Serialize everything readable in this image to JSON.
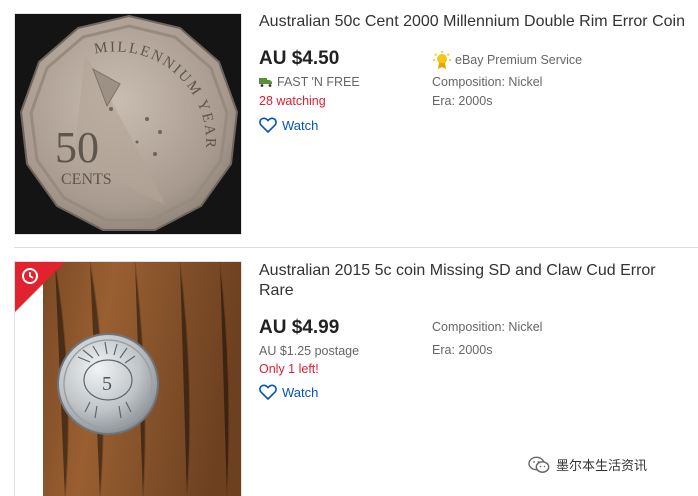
{
  "listings": [
    {
      "title": "Australian 50c Cent 2000 Millennium Double Rim Error Coin",
      "price": "AU $4.50",
      "shipping": "FAST 'N FREE",
      "watching": "28 watching",
      "watch_label": "Watch",
      "premium_label": "eBay Premium Service",
      "composition": "Composition: Nickel",
      "era": "Era: 2000s",
      "coin_text_top": "MILLENNIUM YEAR",
      "coin_text_value": "50",
      "coin_text_unit": "CENTS"
    },
    {
      "title": "Australian 2015 5c coin Missing SD and Claw Cud Error Rare",
      "price": "AU $4.99",
      "postage": "AU $1.25 postage",
      "stock": "Only 1 left!",
      "watch_label": "Watch",
      "composition": "Composition: Nickel",
      "era": "Era: 2000s"
    }
  ],
  "watermark": "墨尔本生活资讯",
  "colors": {
    "link": "#0654ba",
    "alert": "#dd1e31",
    "badge": "#e0232e"
  }
}
